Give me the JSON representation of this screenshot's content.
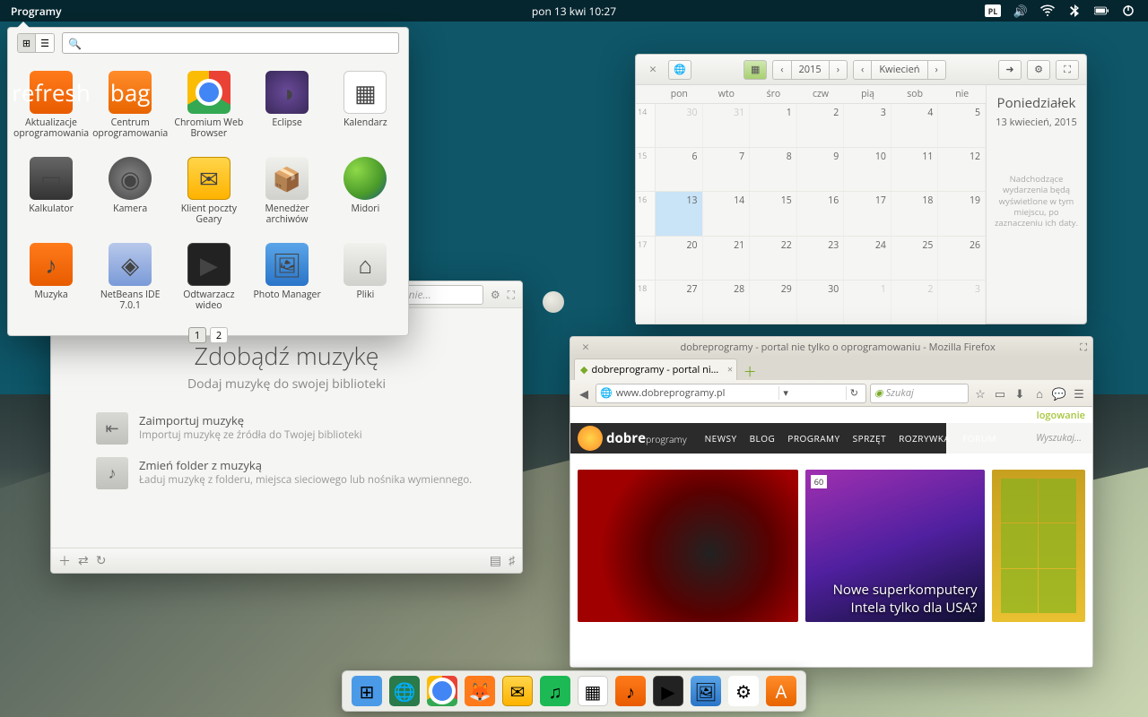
{
  "panel": {
    "menu": "Programy",
    "clock": "pon 13 kwi   10:27",
    "kb": "PL"
  },
  "launcher": {
    "search_placeholder": "",
    "pages": [
      "1",
      "2"
    ],
    "apps": [
      {
        "label": "Aktualizacje oprogramowania",
        "icon": "refresh",
        "cls": "ic-orange"
      },
      {
        "label": "Centrum oprogramowania",
        "icon": "bag",
        "cls": "ic-orange2"
      },
      {
        "label": "Chromium Web Browser",
        "icon": "",
        "cls": "ic-chrome"
      },
      {
        "label": "Eclipse",
        "icon": "◑",
        "cls": "ic-purple"
      },
      {
        "label": "Kalendarz",
        "icon": "▦",
        "cls": "ic-cal"
      },
      {
        "label": "Kalkulator",
        "icon": "▭",
        "cls": "ic-calc"
      },
      {
        "label": "Kamera",
        "icon": "◉",
        "cls": "ic-cam"
      },
      {
        "label": "Klient poczty Geary",
        "icon": "✉",
        "cls": "ic-mail"
      },
      {
        "label": "Menedżer archiwów",
        "icon": "📦",
        "cls": "ic-arch"
      },
      {
        "label": "Midori",
        "icon": "",
        "cls": "ic-midori"
      },
      {
        "label": "Muzyka",
        "icon": "♪",
        "cls": "ic-music"
      },
      {
        "label": "NetBeans IDE 7.0.1",
        "icon": "◈",
        "cls": "ic-nb"
      },
      {
        "label": "Odtwarzacz wideo",
        "icon": "▶",
        "cls": "ic-vid"
      },
      {
        "label": "Photo Manager",
        "icon": "🖼",
        "cls": "ic-photo"
      },
      {
        "label": "Pliki",
        "icon": "⌂",
        "cls": "ic-files"
      }
    ]
  },
  "music": {
    "search_placeholder": "szukiwanie…",
    "title": "Zdobądź muzykę",
    "subtitle": "Dodaj muzykę do swojej biblioteki",
    "actions": [
      {
        "t": "Zaimportuj muzykę",
        "d": "Importuj muzykę ze źródła do Twojej biblioteki",
        "i": "⇤"
      },
      {
        "t": "Zmień folder z muzyką",
        "d": "Ładuj muzykę z folderu, miejsca sieciowego lub nośnika wymiennego.",
        "i": "♪"
      }
    ]
  },
  "calendar": {
    "year": "2015",
    "month": "Kwiecień",
    "dow": [
      "pon",
      "wto",
      "śro",
      "czw",
      "pią",
      "sob",
      "nie"
    ],
    "side_day": "Poniedziałek",
    "side_date": "13 kwiecień, 2015",
    "side_hint": "Nadchodzące wydarzenia będą wyświetlone w tym miejscu, po zaznaczeniu ich daty.",
    "weeks": [
      {
        "wn": "14",
        "days": [
          {
            "n": "30",
            "off": true
          },
          {
            "n": "31",
            "off": true
          },
          {
            "n": "1"
          },
          {
            "n": "2"
          },
          {
            "n": "3"
          },
          {
            "n": "4"
          },
          {
            "n": "5"
          }
        ]
      },
      {
        "wn": "15",
        "days": [
          {
            "n": "6"
          },
          {
            "n": "7"
          },
          {
            "n": "8"
          },
          {
            "n": "9"
          },
          {
            "n": "10"
          },
          {
            "n": "11"
          },
          {
            "n": "12"
          }
        ]
      },
      {
        "wn": "16",
        "days": [
          {
            "n": "13",
            "today": true
          },
          {
            "n": "14"
          },
          {
            "n": "15"
          },
          {
            "n": "16"
          },
          {
            "n": "17"
          },
          {
            "n": "18"
          },
          {
            "n": "19"
          }
        ]
      },
      {
        "wn": "17",
        "days": [
          {
            "n": "20"
          },
          {
            "n": "21"
          },
          {
            "n": "22"
          },
          {
            "n": "23"
          },
          {
            "n": "24"
          },
          {
            "n": "25"
          },
          {
            "n": "26"
          }
        ]
      },
      {
        "wn": "18",
        "days": [
          {
            "n": "27"
          },
          {
            "n": "28"
          },
          {
            "n": "29"
          },
          {
            "n": "30"
          },
          {
            "n": "1",
            "off": true
          },
          {
            "n": "2",
            "off": true
          },
          {
            "n": "3",
            "off": true
          }
        ]
      }
    ]
  },
  "firefox": {
    "title": "dobreprogramy - portal nie tylko o oprogramowaniu - Mozilla Firefox",
    "tab": "dobreprogramy - portal ni…",
    "url": "www.dobreprogramy.pl",
    "search_placeholder": "Szukaj",
    "login": "logowanie",
    "brand_a": "dobre",
    "brand_b": "programy",
    "nav": [
      "NEWSY",
      "BLOG",
      "PROGRAMY",
      "SPRZĘT",
      "ROZRYWKA",
      "FORUM"
    ],
    "nav_search": "Wyszukaj…",
    "article_badge": "60",
    "article_title": "Nowe superkomputery Intela tylko dla USA?"
  },
  "dock": [
    {
      "cls": "",
      "bg": "#4a9ae8",
      "i": "⊞"
    },
    {
      "cls": "",
      "bg": "#2a7a4a",
      "i": "🌐"
    },
    {
      "cls": "ic-chrome",
      "bg": "",
      "i": ""
    },
    {
      "cls": "",
      "bg": "#ff7a1a",
      "i": "🦊"
    },
    {
      "cls": "ic-mail",
      "bg": "",
      "i": "✉"
    },
    {
      "cls": "",
      "bg": "#1db954",
      "i": "♫"
    },
    {
      "cls": "ic-cal",
      "bg": "",
      "i": "▦"
    },
    {
      "cls": "ic-music",
      "bg": "",
      "i": "♪"
    },
    {
      "cls": "ic-vid",
      "bg": "",
      "i": "▶"
    },
    {
      "cls": "ic-photo",
      "bg": "",
      "i": "🖼"
    },
    {
      "cls": "",
      "bg": "#fff",
      "i": "⚙"
    },
    {
      "cls": "ic-orange2",
      "bg": "",
      "i": "A"
    }
  ]
}
